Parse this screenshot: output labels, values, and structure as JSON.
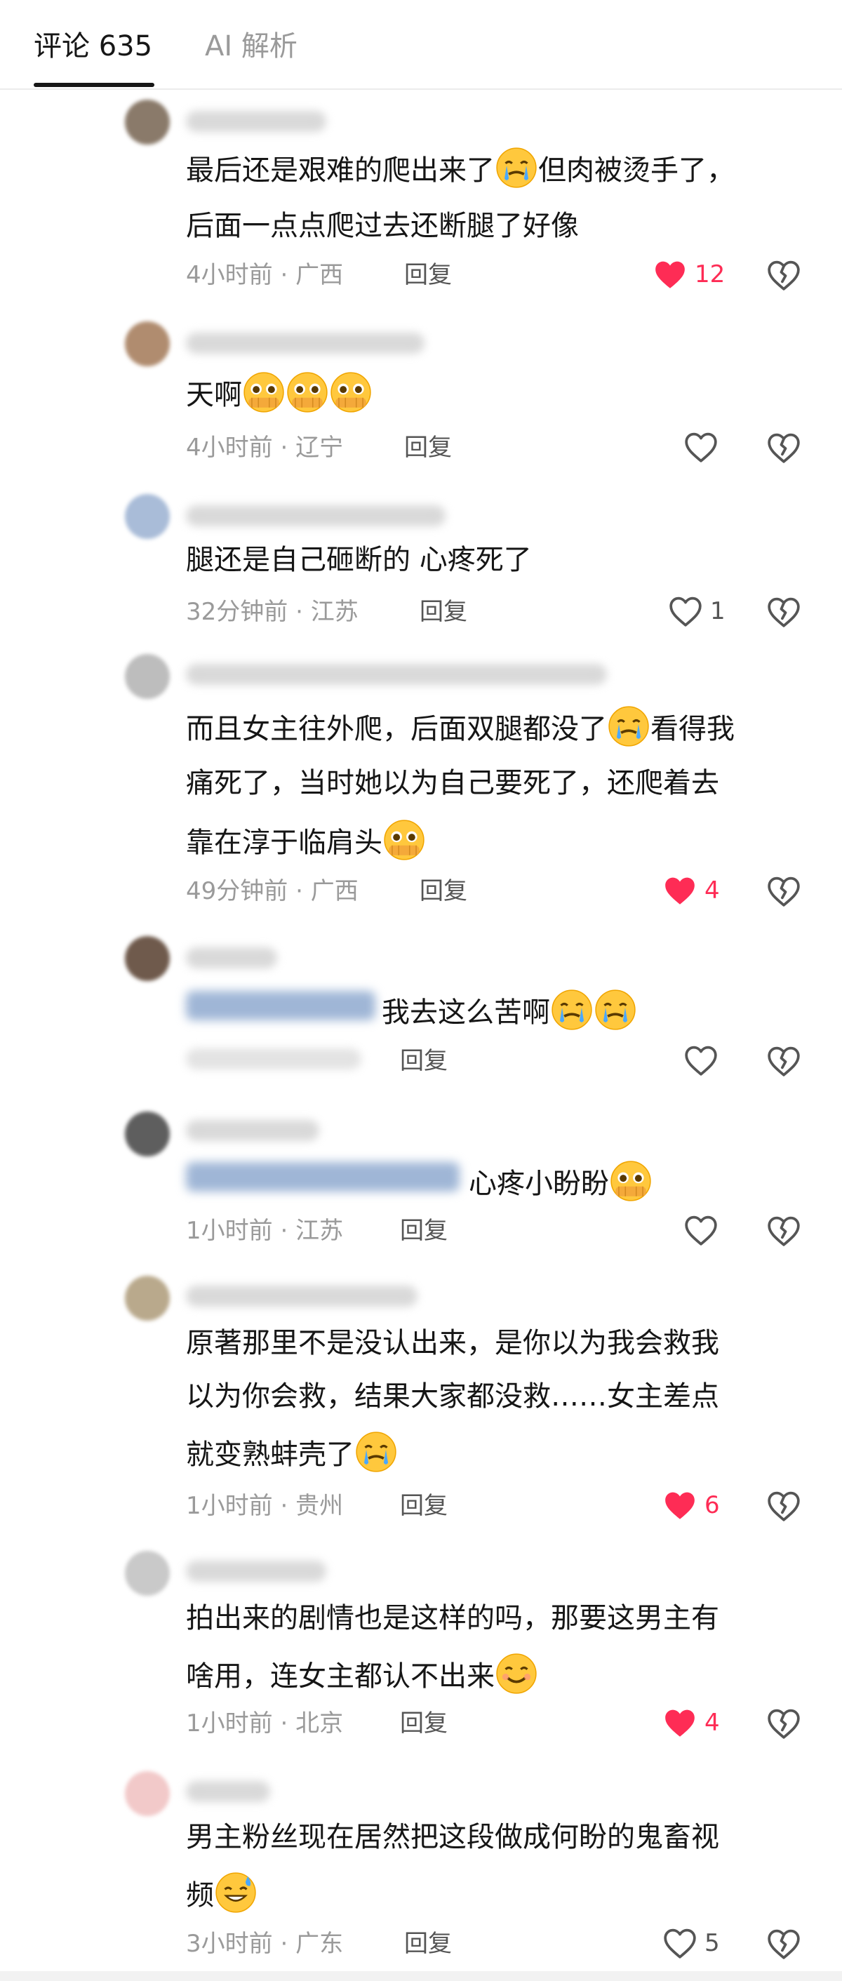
{
  "tabs": [
    {
      "label": "评论 635",
      "active": true
    },
    {
      "label": "AI 解析",
      "active": false
    }
  ],
  "colors": {
    "accent": "#fe2c55",
    "text": "#161616",
    "meta": "#9a9a9a"
  },
  "comments": [
    {
      "lines": [
        "最后还是艰难的爬出来了",
        "但肉被烫手了，",
        "后面一点点爬过去还断腿了好像"
      ],
      "time": "4小时前",
      "location": "广西",
      "reply_label": "回复",
      "likes": "12",
      "liked": true
    },
    {
      "lines": [
        "天啊"
      ],
      "time": "4小时前",
      "location": "辽宁",
      "reply_label": "回复",
      "likes": "",
      "liked": false
    },
    {
      "lines": [
        "腿还是自己砸断的 心疼死了"
      ],
      "time": "32分钟前",
      "location": "江苏",
      "reply_label": "回复",
      "likes": "1",
      "liked": false
    },
    {
      "lines": [
        "而且女主往外爬，后面双腿都没了",
        "看得我",
        "痛死了，当时她以为自己要死了，还爬着去",
        "靠在淳于临肩头"
      ],
      "time": "49分钟前",
      "location": "广西",
      "reply_label": "回复",
      "likes": "4",
      "liked": true
    },
    {
      "lines": [
        "我去这么苦啊"
      ],
      "time": "",
      "location": "",
      "reply_label": "回复",
      "likes": "",
      "liked": false
    },
    {
      "lines": [
        "心疼小盼盼"
      ],
      "time": "1小时前",
      "location": "江苏",
      "reply_label": "回复",
      "likes": "",
      "liked": false
    },
    {
      "lines": [
        "原著那里不是没认出来，是你以为我会救我",
        "以为你会救，结果大家都没救……女主差点",
        "就变熟蚌壳了"
      ],
      "time": "1小时前",
      "location": "贵州",
      "reply_label": "回复",
      "likes": "6",
      "liked": true
    },
    {
      "lines": [
        "拍出来的剧情也是这样的吗，那要这男主有",
        "啥用，连女主都认不出来"
      ],
      "time": "1小时前",
      "location": "北京",
      "reply_label": "回复",
      "likes": "4",
      "liked": true
    },
    {
      "lines": [
        "男主粉丝现在居然把这段做成何盼的鬼畜视",
        "频"
      ],
      "time": "3小时前",
      "location": "广东",
      "reply_label": "回复",
      "likes": "5",
      "liked": false
    }
  ],
  "meta_separator": "·",
  "icons": {
    "like": "heart-icon",
    "dislike": "broken-heart-icon",
    "emoji": "crying-face-emoji"
  }
}
